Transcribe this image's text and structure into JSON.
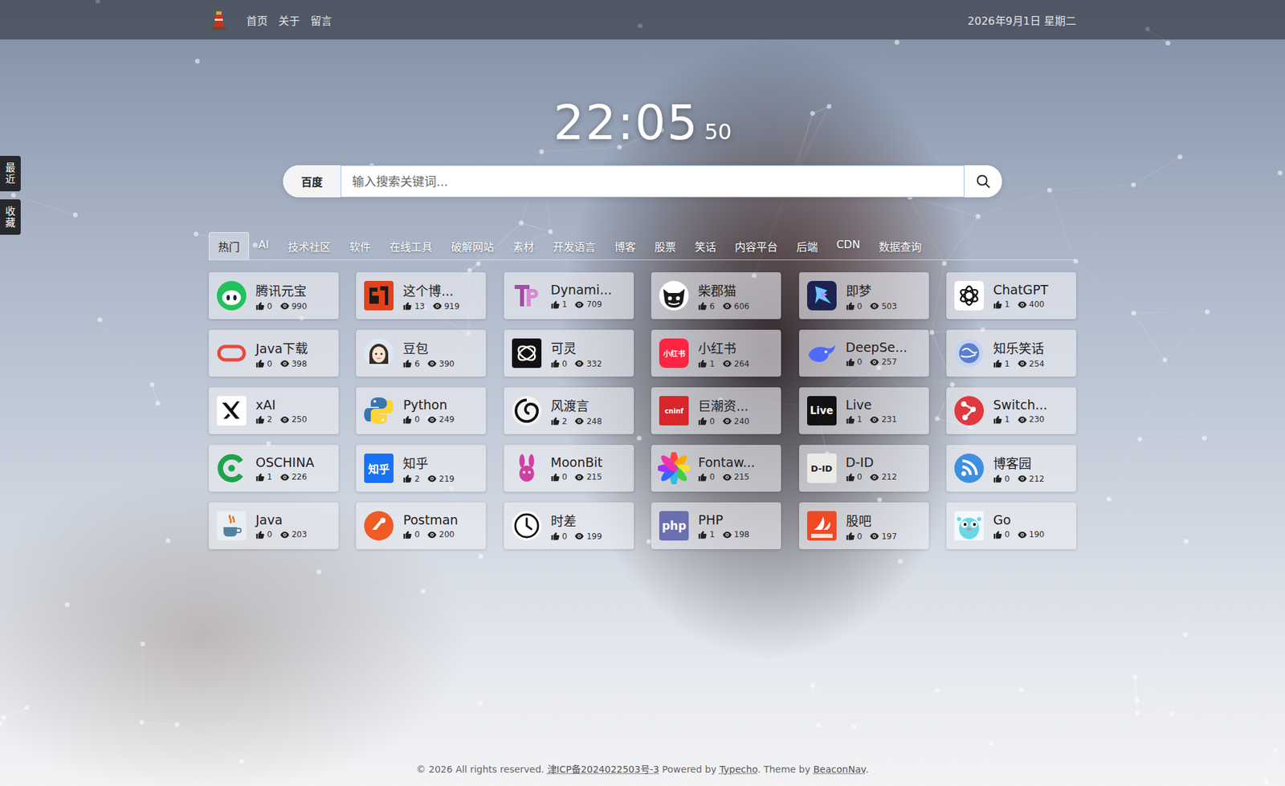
{
  "header": {
    "nav": [
      "首页",
      "关于",
      "留言"
    ],
    "date": "2026年9月1日 星期二"
  },
  "clock": {
    "time": "22:05",
    "seconds": "50"
  },
  "search": {
    "engine": "百度",
    "placeholder": "输入搜索关键词..."
  },
  "side_tabs": [
    "最近",
    "收藏"
  ],
  "tabs": [
    {
      "label": "热门",
      "selected": true
    },
    {
      "label": "AI",
      "selected": false
    },
    {
      "label": "技术社区",
      "selected": false
    },
    {
      "label": "软件",
      "selected": false
    },
    {
      "label": "在线工具",
      "selected": false
    },
    {
      "label": "破解网站",
      "selected": false
    },
    {
      "label": "素材",
      "selected": false
    },
    {
      "label": "开发语言",
      "selected": false
    },
    {
      "label": "博客",
      "selected": false
    },
    {
      "label": "股票",
      "selected": false
    },
    {
      "label": "笑话",
      "selected": false
    },
    {
      "label": "内容平台",
      "selected": false
    },
    {
      "label": "后端",
      "selected": false
    },
    {
      "label": "CDN",
      "selected": false
    },
    {
      "label": "数据查询",
      "selected": false
    }
  ],
  "cards": [
    {
      "title": "腾讯元宝",
      "likes": "0",
      "views": "990"
    },
    {
      "title": "这个博...",
      "likes": "13",
      "views": "919"
    },
    {
      "title": "Dynami...",
      "likes": "1",
      "views": "709"
    },
    {
      "title": "柴郡猫",
      "likes": "6",
      "views": "606"
    },
    {
      "title": "即梦",
      "likes": "0",
      "views": "503"
    },
    {
      "title": "ChatGPT",
      "likes": "1",
      "views": "400"
    },
    {
      "title": "Java下载",
      "likes": "0",
      "views": "398"
    },
    {
      "title": "豆包",
      "likes": "6",
      "views": "390"
    },
    {
      "title": "可灵",
      "likes": "0",
      "views": "332"
    },
    {
      "title": "小红书",
      "likes": "1",
      "views": "264",
      "icon_text": "小红书"
    },
    {
      "title": "DeepSe...",
      "likes": "0",
      "views": "257"
    },
    {
      "title": "知乐笑话",
      "likes": "1",
      "views": "254"
    },
    {
      "title": "xAI",
      "likes": "2",
      "views": "250"
    },
    {
      "title": "Python",
      "likes": "0",
      "views": "249"
    },
    {
      "title": "风渡言",
      "likes": "2",
      "views": "248"
    },
    {
      "title": "巨潮资...",
      "likes": "0",
      "views": "240",
      "icon_text": "cninf"
    },
    {
      "title": "Live",
      "likes": "1",
      "views": "231",
      "icon_text": "Live"
    },
    {
      "title": "Switch...",
      "likes": "1",
      "views": "230"
    },
    {
      "title": "OSCHINA",
      "likes": "1",
      "views": "226"
    },
    {
      "title": "知乎",
      "likes": "2",
      "views": "219",
      "icon_text": "知乎"
    },
    {
      "title": "MoonBit",
      "likes": "0",
      "views": "215"
    },
    {
      "title": "Fontaw...",
      "likes": "0",
      "views": "215"
    },
    {
      "title": "D-ID",
      "likes": "0",
      "views": "212",
      "icon_text": "D-ID"
    },
    {
      "title": "博客园",
      "likes": "0",
      "views": "212"
    },
    {
      "title": "Java",
      "likes": "0",
      "views": "203"
    },
    {
      "title": "Postman",
      "likes": "0",
      "views": "200"
    },
    {
      "title": "时差",
      "likes": "0",
      "views": "199"
    },
    {
      "title": "PHP",
      "likes": "1",
      "views": "198",
      "icon_text": "php"
    },
    {
      "title": "股吧",
      "likes": "0",
      "views": "197"
    },
    {
      "title": "Go",
      "likes": "0",
      "views": "190"
    }
  ],
  "footer": [
    {
      "text": "© 2026 All rights reserved. ",
      "link": false
    },
    {
      "text": "津ICP备2024022503号-3",
      "link": true
    },
    {
      "text": " Powered by ",
      "link": false
    },
    {
      "text": "Typecho",
      "link": true
    },
    {
      "text": ". Theme by ",
      "link": false
    },
    {
      "text": "BeaconNav",
      "link": true
    },
    {
      "text": ".",
      "link": false
    }
  ]
}
